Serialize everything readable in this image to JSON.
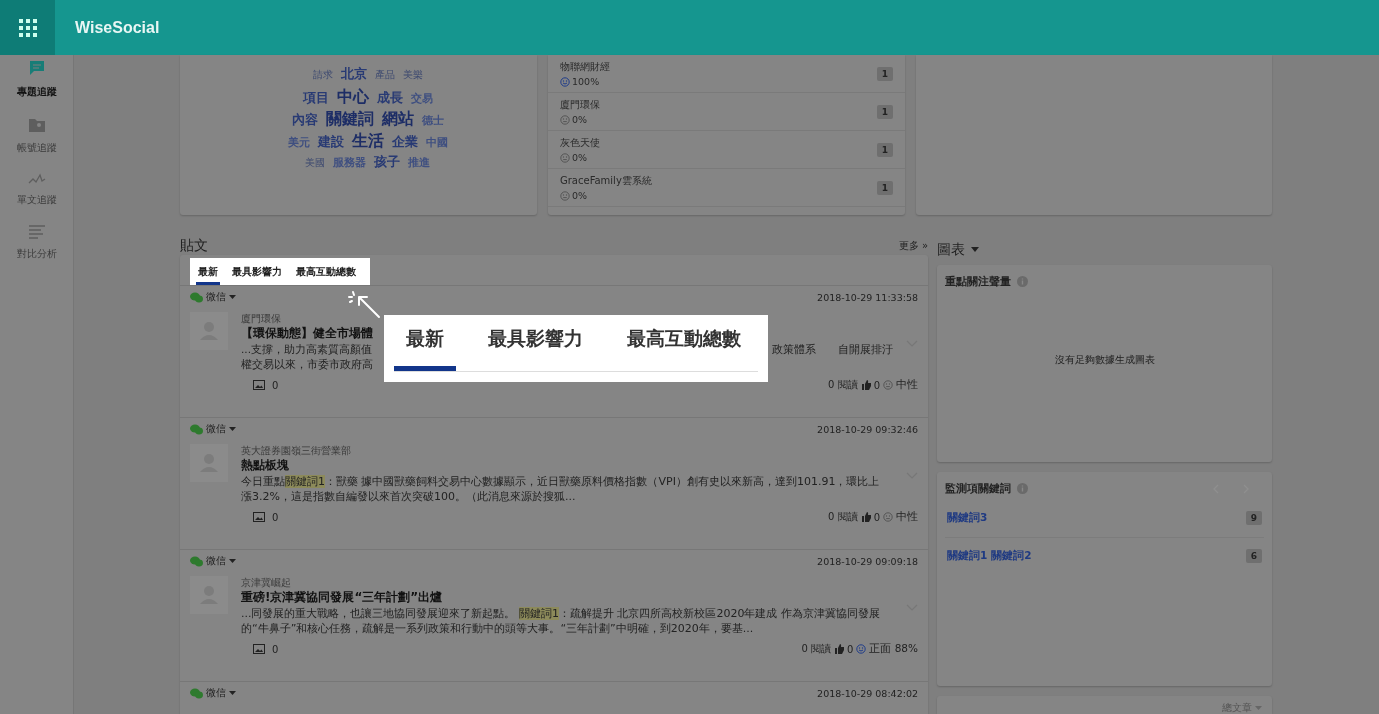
{
  "app": {
    "name": "WiseSocial"
  },
  "sidebar": {
    "items": [
      {
        "label": "專題追蹤",
        "selected": true
      },
      {
        "label": "帳號追蹤",
        "selected": false
      },
      {
        "label": "單文追蹤",
        "selected": false
      },
      {
        "label": "對比分析",
        "selected": false
      }
    ]
  },
  "word_cloud": {
    "rows": [
      [
        {
          "text": "請求",
          "kind": "faint"
        },
        {
          "text": "北京",
          "kind": "medium"
        },
        {
          "text": "產品",
          "kind": "faint"
        },
        {
          "text": "美樂",
          "kind": "faint"
        }
      ],
      [
        {
          "text": "項目",
          "kind": "medium"
        },
        {
          "text": "中心",
          "kind": "large"
        },
        {
          "text": "成長",
          "kind": "medium"
        },
        {
          "text": "交易",
          "kind": "small"
        }
      ],
      [
        {
          "text": "內容",
          "kind": "medium"
        },
        {
          "text": "關鍵詞",
          "kind": "large"
        },
        {
          "text": "網站",
          "kind": "large"
        },
        {
          "text": "德士",
          "kind": "small"
        }
      ],
      [
        {
          "text": "美元",
          "kind": "small"
        },
        {
          "text": "建設",
          "kind": "medium"
        },
        {
          "text": "生活",
          "kind": "large"
        },
        {
          "text": "企業",
          "kind": "medium"
        },
        {
          "text": "中國",
          "kind": "small"
        }
      ],
      [
        {
          "text": "美國",
          "kind": "faint"
        },
        {
          "text": "服務器",
          "kind": "small"
        },
        {
          "text": "孩子",
          "kind": "medium"
        },
        {
          "text": "推進",
          "kind": "small"
        }
      ]
    ]
  },
  "accounts": [
    {
      "name": "物聯網財經",
      "kind": "positive",
      "percent": "100%",
      "count": "1"
    },
    {
      "name": "廈門環保",
      "kind": "neutral",
      "percent": "0%",
      "count": "1"
    },
    {
      "name": "灰色天使",
      "kind": "neutral",
      "percent": "0%",
      "count": "1"
    },
    {
      "name": "GraceFamily雲系統",
      "kind": "neutral",
      "percent": "0%",
      "count": "1"
    }
  ],
  "posts_section": {
    "title": "貼文",
    "more": "更多 »",
    "tabs": [
      {
        "label": "最新",
        "selected": true
      },
      {
        "label": "最具影響力",
        "selected": false
      },
      {
        "label": "最高互動總數",
        "selected": false
      }
    ],
    "callout_tabs": [
      {
        "label": "最新",
        "selected": true
      },
      {
        "label": "最具影響力",
        "selected": false
      },
      {
        "label": "最高互動總數",
        "selected": false
      }
    ],
    "posts": [
      {
        "source": "微信",
        "time": "2018-10-29 11:33:58",
        "author": "廈門環保",
        "title": "【環保動態】健全市場體",
        "kind": "covered",
        "body_left": [
          "...支撐，助力高素質高顏值",
          "權交易以來，市委市政府高"
        ],
        "body_right": [
          "政策體系",
          "自開展排汙"
        ],
        "images": "0",
        "reads": "0 閱讀",
        "likes": "0",
        "sentiment": {
          "kind": "neutral",
          "text": "中性"
        }
      },
      {
        "source": "微信",
        "time": "2018-10-29 09:32:46",
        "author": "英大證券園嶺三街營業部",
        "title": "熱點板塊",
        "kind": "full",
        "body": [
          {
            "text": "今日重點",
            "highlight": false
          },
          {
            "text": "關鍵詞1",
            "highlight": true
          },
          {
            "text": "：獸藥 據中國獸藥飼料交易中心數據顯示，近日獸藥原料價格指數（VPI）創有史以來新高，達到101.91，環比上漲3.2%，這是指數自編發以來首次突破100。（此消息來源於搜狐...",
            "highlight": false
          }
        ],
        "images": "0",
        "reads": "0 閱讀",
        "likes": "0",
        "sentiment": {
          "kind": "neutral",
          "text": "中性"
        }
      },
      {
        "source": "微信",
        "time": "2018-10-29 09:09:18",
        "author": "京津冀崛起",
        "title": "重磅!京津冀協同發展“三年計劃”出爐",
        "kind": "full",
        "body": [
          {
            "text": "...同發展的重大戰略，也讓三地協同發展迎來了新起點。 ",
            "highlight": false
          },
          {
            "text": "關鍵詞1",
            "highlight": true
          },
          {
            "text": "：疏解提升 北京四所高校新校區2020年建成 作為京津冀協同發展的“牛鼻子”和核心任務，疏解是一系列政策和行動中的頭等大事。“三年計劃”中明確，到2020年，要基...",
            "highlight": false
          }
        ],
        "images": "0",
        "reads": "0 閱讀",
        "likes": "0",
        "sentiment": {
          "kind": "positive",
          "text": "正面 88%"
        }
      },
      {
        "source": "微信",
        "time": "2018-10-29 08:42:02",
        "kind": "header"
      }
    ]
  },
  "charts_section": {
    "title": "圖表",
    "volume_card": {
      "title": "重點關注聲量",
      "empty_text": "沒有足夠數據生成圖表"
    },
    "keywords_card": {
      "title": "監測項關鍵詞",
      "rows": [
        {
          "keywords": [
            "關鍵詞3"
          ],
          "count": "9"
        },
        {
          "keywords": [
            "關鍵詞1",
            "關鍵詞2"
          ],
          "count": "6"
        }
      ]
    },
    "third_card": {
      "dropdown": "總文章"
    }
  }
}
